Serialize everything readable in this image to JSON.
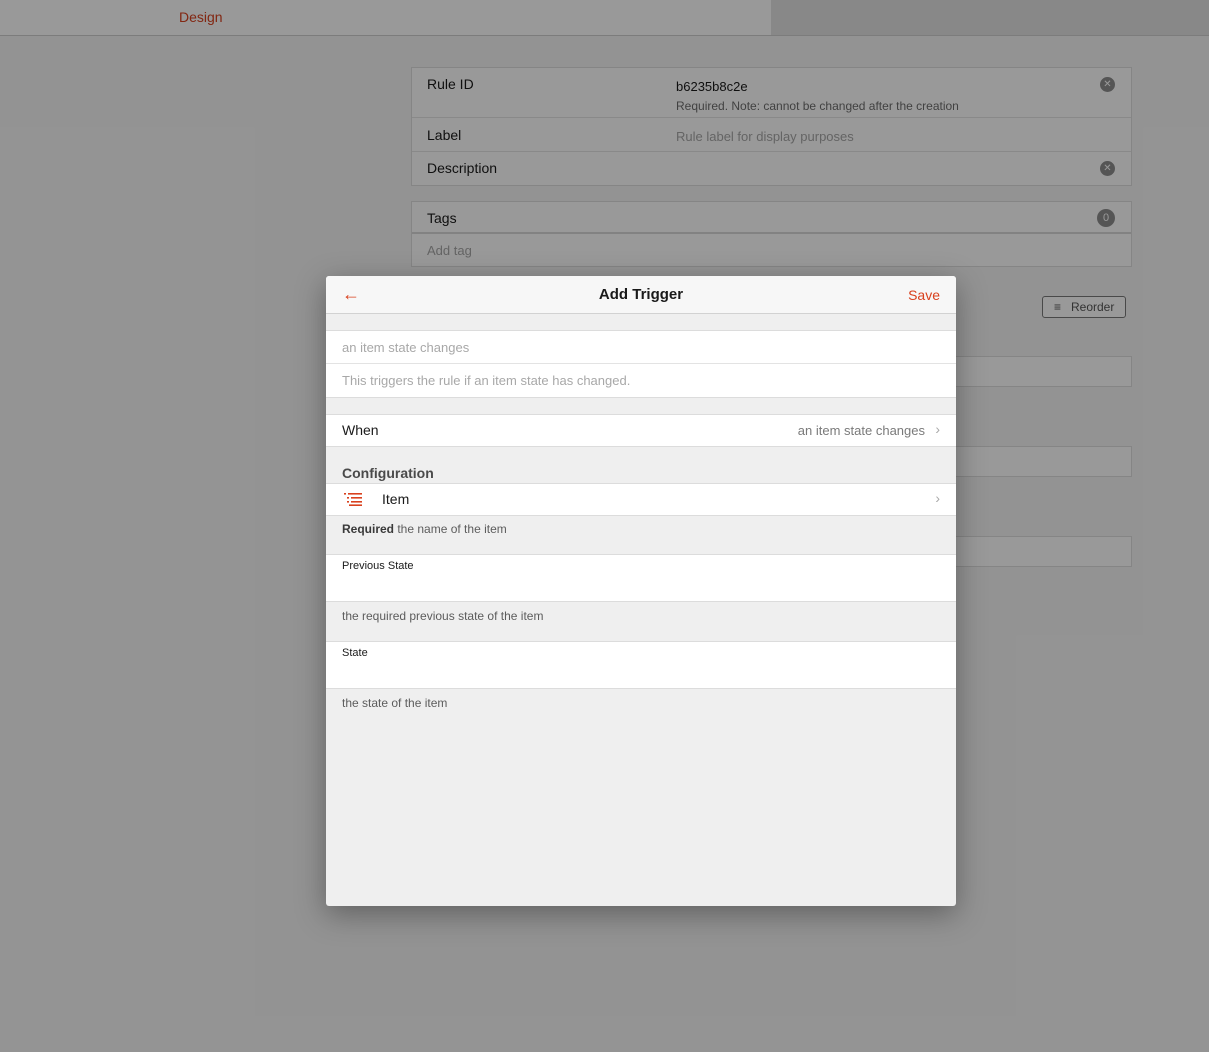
{
  "topbar": {
    "design_tab": "Design"
  },
  "rule_form": {
    "rule_id_label": "Rule ID",
    "rule_id_value": "b6235b8c2e",
    "rule_id_hint": "Required. Note: cannot be changed after the creation",
    "label_label": "Label",
    "label_placeholder": "Rule label for display purposes",
    "description_label": "Description",
    "clear_symbol": "✕"
  },
  "tags": {
    "label": "Tags",
    "count": "0",
    "add_placeholder": "Add tag"
  },
  "reorder": {
    "label": "Reorder",
    "icon": "≡"
  },
  "modal": {
    "title": "Add Trigger",
    "back_icon": "←",
    "save_label": "Save",
    "trigger_label_placeholder": "an item state changes",
    "trigger_description_placeholder": "This triggers the rule if an item state has changed.",
    "when": {
      "label": "When",
      "value": "an item state changes",
      "chevron": "›"
    },
    "configuration": {
      "title": "Configuration",
      "item": {
        "label": "Item",
        "chevron": "›",
        "help_strong": "Required",
        "help_text": " the name of the item"
      },
      "previous_state": {
        "label": "Previous State",
        "value": "",
        "help": "the required previous state of the item"
      },
      "state": {
        "label": "State",
        "value": "",
        "help": "the state of the item"
      }
    }
  },
  "colors": {
    "accent": "#d9411e",
    "overlay": "rgba(0,0,0,0.4)"
  }
}
